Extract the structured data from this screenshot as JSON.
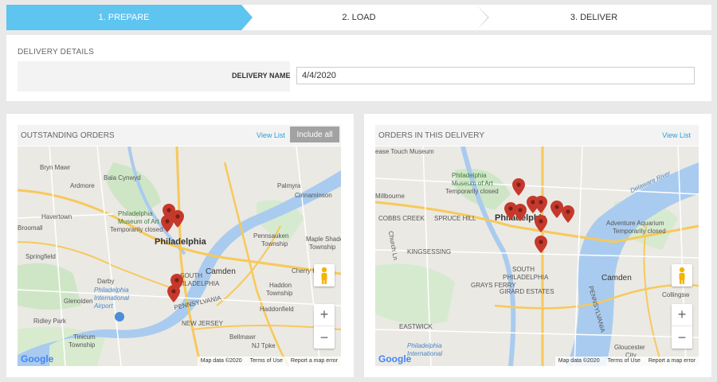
{
  "stepper": {
    "steps": [
      {
        "label": "1. PREPARE",
        "active": true
      },
      {
        "label": "2. LOAD",
        "active": false
      },
      {
        "label": "3. DELIVER",
        "active": false
      }
    ],
    "active_color": "#5ec4f0"
  },
  "details": {
    "title": "DELIVERY DETAILS",
    "name_label": "DELIVERY NAME",
    "name_value": "4/4/2020"
  },
  "outstanding": {
    "title": "OUTSTANDING ORDERS",
    "view_list": "View List",
    "include_all": "Include all",
    "map": {
      "labels": {
        "bryn_mawr": "Bryn Mawr",
        "bala_cynwyd": "Bala Cynwyd",
        "ardmore": "Ardmore",
        "havertown": "Havertown",
        "broomall": "Broomall",
        "springfield": "Springfield",
        "darby": "Darby",
        "glenolden": "Glenolden",
        "ridley_park": "Ridley Park",
        "tinicum": "Tinicum",
        "tinicum2": "Township",
        "philly": "Philadelphia",
        "museum1": "Philadelphia",
        "museum2": "Museum of Art",
        "museum3": "Temporarily closed",
        "airport1": "Philadelphia",
        "airport2": "International",
        "airport3": "Airport",
        "palmyra": "Palmyra",
        "cinnaminson": "Cinnaminson",
        "pennsauken1": "Pennsauken",
        "pennsauken2": "Township",
        "maple1": "Maple Shade",
        "maple2": "Township",
        "cherry": "Cherry H",
        "camden": "Camden",
        "haddon1": "Haddon",
        "haddon2": "Township",
        "haddonfield": "Haddonfield",
        "bellmawr": "Bellmawr",
        "south_phl": "SOUTH",
        "south_phl2": "PHILADELPHIA",
        "pennsylvania": "PENNSYLVANIA",
        "new_jersey": "NEW JERSEY",
        "nj_tpke": "NJ Tpke"
      },
      "google": "Google",
      "map_data": "Map data ©2020",
      "terms": "Terms of Use",
      "report": "Report a map error",
      "zoom_in": "+",
      "zoom_out": "−"
    }
  },
  "in_delivery": {
    "title": "ORDERS IN THIS DELIVERY",
    "view_list": "View List",
    "map": {
      "labels": {
        "touch": "ease Touch Museum",
        "museum1": "Philadelphia",
        "museum2": "Museum of Art",
        "museum3": "Temporarily closed",
        "millbourne": "Millbourne",
        "cobbs": "COBBS CREEK",
        "spruce": "SPRUCE HILL",
        "philly": "Philadelphia",
        "kingsessing": "KINGSESSING",
        "south1": "SOUTH",
        "south2": "PHILADELPHIA",
        "grays": "GRAYS FERRY",
        "girard": "GIRARD ESTATES",
        "eastwick": "EASTWICK",
        "adventure1": "Adventure Aquarium",
        "adventure2": "Temporarily closed",
        "camden": "Camden",
        "collingswood": "Collingsw",
        "gloucester1": "Gloucester",
        "gloucester2": "City",
        "delaware": "Delaware River",
        "pennsylvania": "PENNSYLVANIA",
        "church": "Church Ln",
        "airport1": "Philadelphia",
        "airport2": "International"
      },
      "google": "Google",
      "map_data": "Map data ©2020",
      "terms": "Terms of Use",
      "report": "Report a map error",
      "zoom_in": "+",
      "zoom_out": "−"
    }
  },
  "pin_color": "#c5392c"
}
